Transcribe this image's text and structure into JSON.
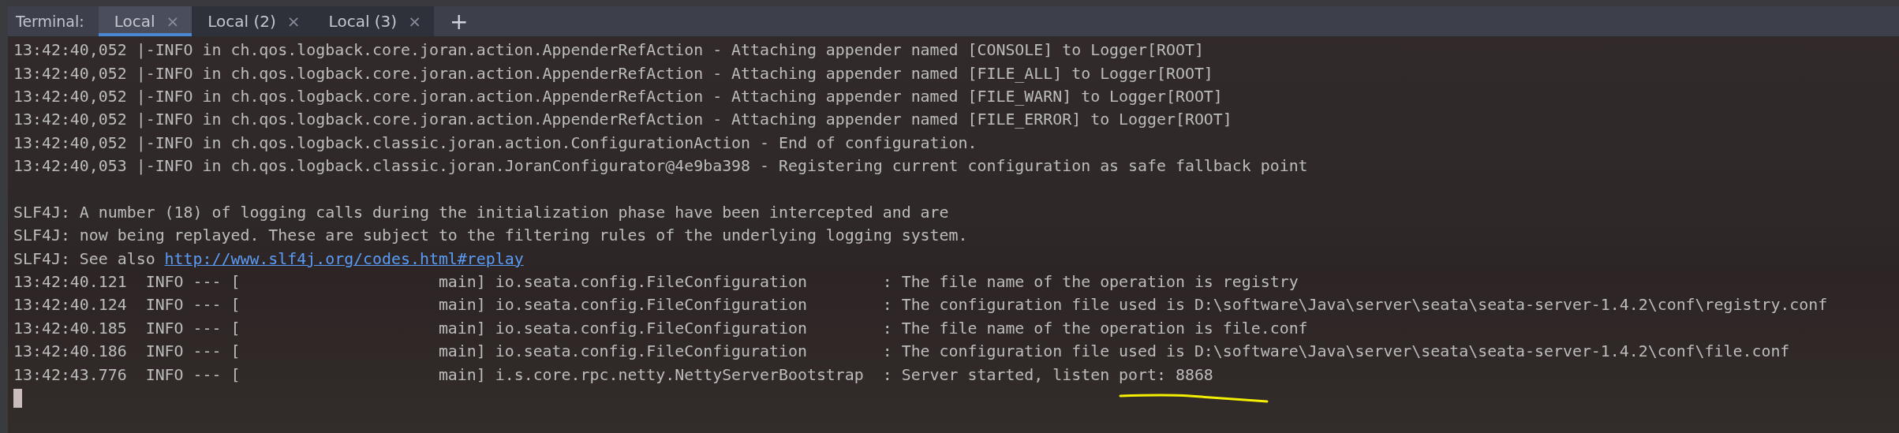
{
  "tool_window": {
    "title": "Terminal:"
  },
  "tabs": [
    {
      "label": "Local",
      "selected": true,
      "close": "×"
    },
    {
      "label": "Local (2)",
      "selected": false,
      "close": "×"
    },
    {
      "label": "Local (3)",
      "selected": false,
      "close": "×"
    }
  ],
  "new_tab": "+",
  "lines": [
    {
      "kind": "text",
      "text": "13:42:40,052 |-INFO in ch.qos.logback.core.joran.action.AppenderRefAction - Attaching appender named [CONSOLE] to Logger[ROOT]"
    },
    {
      "kind": "text",
      "text": "13:42:40,052 |-INFO in ch.qos.logback.core.joran.action.AppenderRefAction - Attaching appender named [FILE_ALL] to Logger[ROOT]"
    },
    {
      "kind": "text",
      "text": "13:42:40,052 |-INFO in ch.qos.logback.core.joran.action.AppenderRefAction - Attaching appender named [FILE_WARN] to Logger[ROOT]"
    },
    {
      "kind": "text",
      "text": "13:42:40,052 |-INFO in ch.qos.logback.core.joran.action.AppenderRefAction - Attaching appender named [FILE_ERROR] to Logger[ROOT]"
    },
    {
      "kind": "text",
      "text": "13:42:40,052 |-INFO in ch.qos.logback.classic.joran.action.ConfigurationAction - End of configuration."
    },
    {
      "kind": "text",
      "text": "13:42:40,053 |-INFO in ch.qos.logback.classic.joran.JoranConfigurator@4e9ba398 - Registering current configuration as safe fallback point"
    },
    {
      "kind": "blank"
    },
    {
      "kind": "text",
      "text": "SLF4J: A number (18) of logging calls during the initialization phase have been intercepted and are"
    },
    {
      "kind": "text",
      "text": "SLF4J: now being replayed. These are subject to the filtering rules of the underlying logging system."
    },
    {
      "kind": "link",
      "text": "SLF4J: See also ",
      "link": "http://www.slf4j.org/codes.html#replay"
    },
    {
      "kind": "text",
      "text": "13:42:40.121  INFO --- [                     main] io.seata.config.FileConfiguration        : The file name of the operation is registry"
    },
    {
      "kind": "text",
      "text": "13:42:40.124  INFO --- [                     main] io.seata.config.FileConfiguration        : The configuration file used is D:\\software\\Java\\server\\seata\\seata-server-1.4.2\\conf\\registry.conf"
    },
    {
      "kind": "text",
      "text": "13:42:40.185  INFO --- [                     main] io.seata.config.FileConfiguration        : The file name of the operation is file.conf"
    },
    {
      "kind": "text",
      "text": "13:42:40.186  INFO --- [                     main] io.seata.config.FileConfiguration        : The configuration file used is D:\\software\\Java\\server\\seata\\seata-server-1.4.2\\conf\\file.conf"
    },
    {
      "kind": "text",
      "text": "13:42:43.776  INFO --- [                     main] i.s.core.rpc.netty.NettyServerBootstrap  : Server started, listen port: 8868"
    },
    {
      "kind": "cursor"
    }
  ]
}
